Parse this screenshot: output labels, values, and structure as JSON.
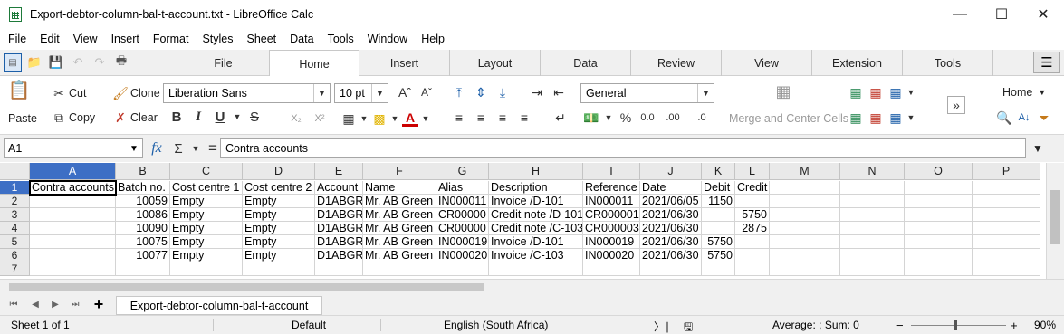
{
  "window": {
    "title": "Export-debtor-column-bal-t-account.txt - LibreOffice Calc"
  },
  "menu": [
    "File",
    "Edit",
    "View",
    "Insert",
    "Format",
    "Styles",
    "Sheet",
    "Data",
    "Tools",
    "Window",
    "Help"
  ],
  "tabs": [
    "File",
    "Home",
    "Insert",
    "Layout",
    "Data",
    "Review",
    "View",
    "Extension",
    "Tools"
  ],
  "active_tab": "Home",
  "ribbon": {
    "paste": "Paste",
    "cut": "Cut",
    "copy": "Copy",
    "clone": "Clone",
    "clear": "Clear",
    "font_name": "Liberation Sans",
    "font_size": "10 pt",
    "number_format": "General",
    "merge_center": "Merge and Center Cells",
    "style_name": "Home"
  },
  "formula_bar": {
    "name_box": "A1",
    "content": "Contra accounts"
  },
  "grid": {
    "columns": [
      "A",
      "B",
      "C",
      "D",
      "E",
      "F",
      "G",
      "H",
      "I",
      "J",
      "K",
      "L",
      "M",
      "N",
      "O",
      "P"
    ],
    "rows": [
      "1",
      "2",
      "3",
      "4",
      "5",
      "6",
      "7"
    ],
    "cells": [
      [
        "Contra accounts",
        "Batch no.",
        "Cost centre 1",
        "Cost centre 2",
        "Account",
        "Name",
        "Alias",
        "Description",
        "Reference",
        "Date",
        "Debit",
        "Credit"
      ],
      [
        "",
        "10059",
        "Empty",
        "Empty",
        "D1ABGR",
        "Mr. AB Green",
        "IN000011",
        "Invoice /D-101",
        "IN000011",
        "2021/06/05",
        "1150",
        ""
      ],
      [
        "",
        "10086",
        "Empty",
        "Empty",
        "D1ABGR",
        "Mr. AB Green",
        "CR00000",
        "Credit note /D-101",
        "CR000001",
        "2021/06/30",
        "",
        "5750"
      ],
      [
        "",
        "10090",
        "Empty",
        "Empty",
        "D1ABGR",
        "Mr. AB Green",
        "CR00000",
        "Credit note /C-103",
        "CR000003",
        "2021/06/30",
        "",
        "2875"
      ],
      [
        "",
        "10075",
        "Empty",
        "Empty",
        "D1ABGR",
        "Mr. AB Green",
        "IN000019",
        "Invoice /D-101",
        "IN000019",
        "2021/06/30",
        "5750",
        ""
      ],
      [
        "",
        "10077",
        "Empty",
        "Empty",
        "D1ABGR",
        "Mr. AB Green",
        "IN000020",
        "Invoice /C-103",
        "IN000020",
        "2021/06/30",
        "5750",
        ""
      ]
    ]
  },
  "sheet_tab": "Export-debtor-column-bal-t-account",
  "status": {
    "sheet": "Sheet 1 of 1",
    "page_style": "Default",
    "language": "English (South Africa)",
    "summary": "Average: ; Sum: 0",
    "zoom": "90%"
  }
}
